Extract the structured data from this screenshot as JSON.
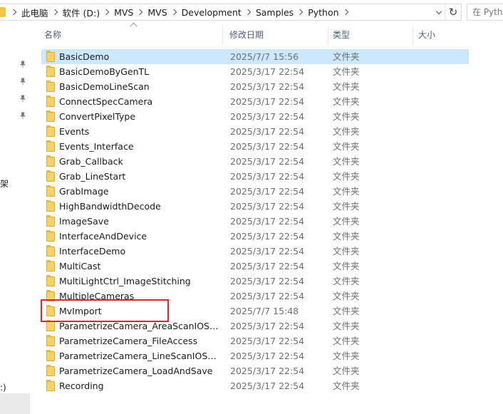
{
  "address_bar": {
    "crumbs": [
      "此电脑",
      "软件 (D:)",
      "MVS",
      "MVS",
      "Development",
      "Samples",
      "Python"
    ]
  },
  "search": {
    "placeholder": "在 Python 中搜索"
  },
  "nav": {
    "frag_mid": "架",
    "frag_bottom": ":)"
  },
  "columns": {
    "name": "名称",
    "date": "修改日期",
    "type": "类型",
    "size": "大小"
  },
  "rows": [
    {
      "name": "BasicDemo",
      "date": "2025/7/7 15:56",
      "type": "文件夹",
      "selected": true
    },
    {
      "name": "BasicDemoByGenTL",
      "date": "2025/3/17 22:54",
      "type": "文件夹"
    },
    {
      "name": "BasicDemoLineScan",
      "date": "2025/3/17 22:54",
      "type": "文件夹"
    },
    {
      "name": "ConnectSpecCamera",
      "date": "2025/3/17 22:54",
      "type": "文件夹"
    },
    {
      "name": "ConvertPixelType",
      "date": "2025/3/17 22:54",
      "type": "文件夹"
    },
    {
      "name": "Events",
      "date": "2025/3/17 22:54",
      "type": "文件夹"
    },
    {
      "name": "Events_Interface",
      "date": "2025/3/17 22:54",
      "type": "文件夹"
    },
    {
      "name": "Grab_Callback",
      "date": "2025/3/17 22:54",
      "type": "文件夹"
    },
    {
      "name": "Grab_LineStart",
      "date": "2025/3/17 22:54",
      "type": "文件夹"
    },
    {
      "name": "GrabImage",
      "date": "2025/3/17 22:54",
      "type": "文件夹"
    },
    {
      "name": "HighBandwidthDecode",
      "date": "2025/3/17 22:54",
      "type": "文件夹"
    },
    {
      "name": "ImageSave",
      "date": "2025/3/17 22:54",
      "type": "文件夹"
    },
    {
      "name": "InterfaceAndDevice",
      "date": "2025/3/17 22:54",
      "type": "文件夹"
    },
    {
      "name": "InterfaceDemo",
      "date": "2025/3/17 22:54",
      "type": "文件夹"
    },
    {
      "name": "MultiCast",
      "date": "2025/3/17 22:54",
      "type": "文件夹"
    },
    {
      "name": "MultiLightCtrl_ImageStitching",
      "date": "2025/3/17 22:54",
      "type": "文件夹"
    },
    {
      "name": "MultipleCameras",
      "date": "2025/3/17 22:54",
      "type": "文件夹"
    },
    {
      "name": "MvImport",
      "date": "2025/7/7 15:48",
      "type": "文件夹",
      "highlighted": true
    },
    {
      "name": "ParametrizeCamera_AreaScanIOSetti...",
      "date": "2025/3/17 22:54",
      "type": "文件夹"
    },
    {
      "name": "ParametrizeCamera_FileAccess",
      "date": "2025/3/17 22:54",
      "type": "文件夹"
    },
    {
      "name": "ParametrizeCamera_LineScanIOSettin...",
      "date": "2025/3/17 22:54",
      "type": "文件夹"
    },
    {
      "name": "ParametrizeCamera_LoadAndSave",
      "date": "2025/3/17 22:54",
      "type": "文件夹"
    },
    {
      "name": "Recording",
      "date": "2025/3/17 22:54",
      "type": "文件夹"
    }
  ],
  "colors": {
    "selection": "#cce8ff",
    "highlight_box": "#e0262a",
    "folder": "#f8d266"
  }
}
